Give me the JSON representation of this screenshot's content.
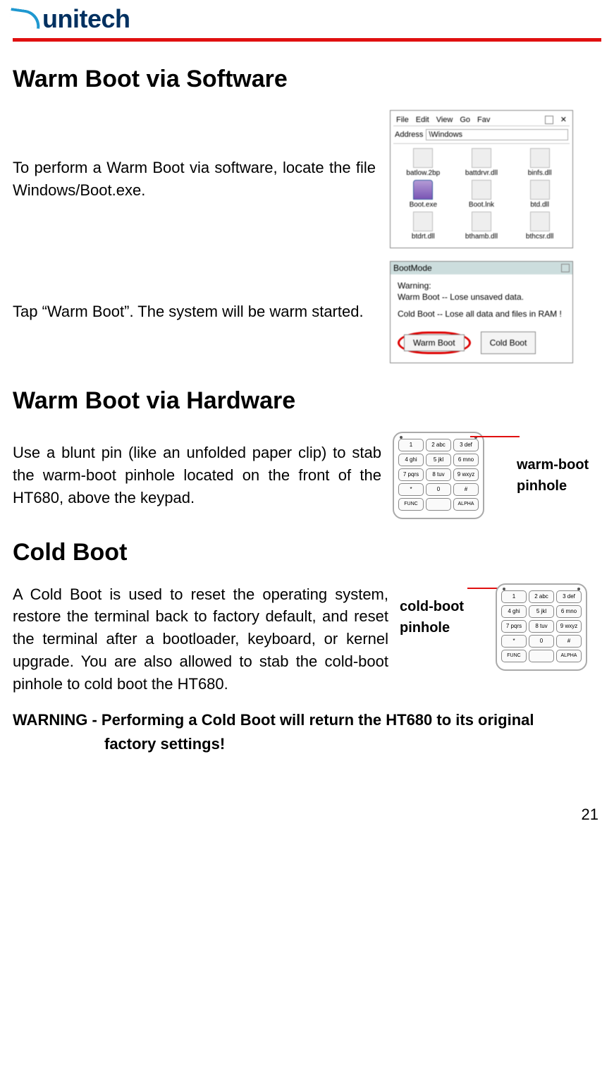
{
  "header": {
    "logo_text": "unitech"
  },
  "section1": {
    "heading": "Warm Boot via Software",
    "step1_text": "To perform a Warm Boot via software, locate the file Windows/Boot.exe.",
    "step2_text": "Tap “Warm Boot”. The system will be warm started."
  },
  "file_browser": {
    "menu": [
      "File",
      "Edit",
      "View",
      "Go",
      "Fav"
    ],
    "address_label": "Address",
    "address_value": "\\Windows",
    "files": [
      "batlow.2bp",
      "battdrvr.dll",
      "binfs.dll",
      "Boot.exe",
      "Boot.lnk",
      "btd.dll",
      "btdrt.dll",
      "bthamb.dll",
      "bthcsr.dll"
    ]
  },
  "bootmode_dialog": {
    "title": "BootMode",
    "warning_line1": "Warning:",
    "warning_line2": "Warm Boot -- Lose unsaved data.",
    "warning_line3": "Cold Boot -- Lose all data and files in RAM !",
    "warm_btn": "Warm Boot",
    "cold_btn": "Cold Boot"
  },
  "section2": {
    "heading": "Warm Boot via Hardware",
    "text": "Use a blunt pin (like an unfolded paper clip) to stab the warm-boot pinhole located on the front of the HT680, above the keypad.",
    "label_line1": "warm-boot",
    "label_line2": "pinhole"
  },
  "section3": {
    "heading": "Cold Boot",
    "text": "A Cold Boot is used to reset the operating system, restore the terminal back to factory default, and reset the terminal after a bootloader, keyboard, or kernel upgrade. You are also allowed to stab the cold-boot pinhole to cold boot the HT680.",
    "label_line1": "cold-boot",
    "label_line2": "pinhole"
  },
  "keypad_keys": [
    "1",
    "2 abc",
    "3 def",
    "4 ghi",
    "5 jkl",
    "6 mno",
    "7 pqrs",
    "8 tuv",
    "9 wxyz",
    "*",
    "0",
    "#",
    "FUNC",
    "",
    "ALPHA"
  ],
  "warning_text": {
    "prefix": "WARNING - ",
    "line1": "Performing a Cold Boot will return the HT680 to its original",
    "line2": "factory settings!"
  },
  "page_number": "21"
}
